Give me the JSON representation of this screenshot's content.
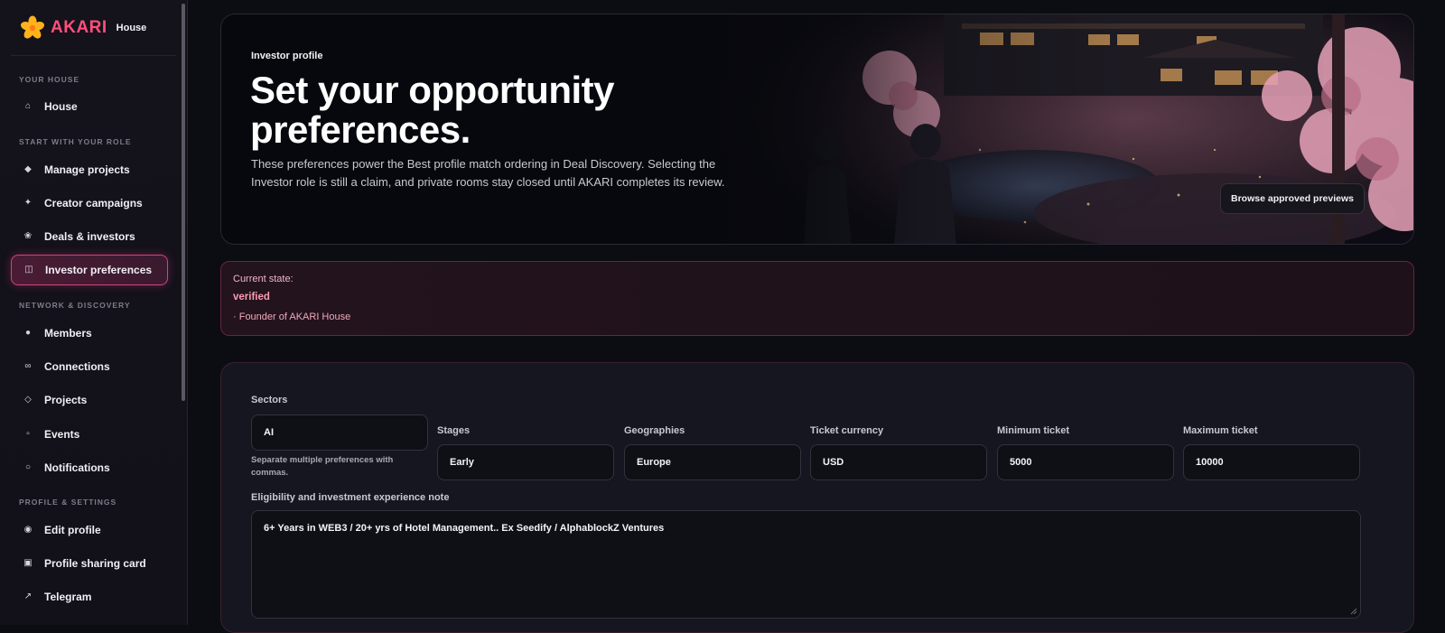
{
  "brand": {
    "name": "AKARI",
    "sub": "House",
    "accent": "#ff4f7a"
  },
  "sidebar": {
    "sections": [
      {
        "title": "YOUR HOUSE",
        "items": [
          {
            "label": "House",
            "icon": "home-icon"
          }
        ]
      },
      {
        "title": "START WITH YOUR ROLE",
        "items": [
          {
            "label": "Manage projects",
            "icon": "diamond-icon"
          },
          {
            "label": "Creator campaigns",
            "icon": "sparkle-icon"
          },
          {
            "label": "Deals & investors",
            "icon": "flower-icon"
          },
          {
            "label": "Investor preferences",
            "icon": "panel-icon",
            "active": true
          }
        ]
      },
      {
        "title": "NETWORK & DISCOVERY",
        "items": [
          {
            "label": "Members",
            "icon": "members-icon"
          },
          {
            "label": "Connections",
            "icon": "infinity-icon"
          },
          {
            "label": "Projects",
            "icon": "diamond-outline-icon"
          },
          {
            "label": "Events",
            "icon": "square-icon"
          },
          {
            "label": "Notifications",
            "icon": "circle-icon"
          }
        ]
      },
      {
        "title": "PROFILE & SETTINGS",
        "items": [
          {
            "label": "Edit profile",
            "icon": "profile-icon"
          },
          {
            "label": "Profile sharing card",
            "icon": "card-icon"
          },
          {
            "label": "Telegram",
            "icon": "arrow-icon"
          }
        ]
      }
    ]
  },
  "hero": {
    "eyebrow": "Investor profile",
    "title": "Set your opportunity preferences.",
    "description": "These preferences power the Best profile match ordering in Deal Discovery. Selecting the Investor role is still a claim, and private rooms stay closed until AKARI completes its review.",
    "button": "Browse approved previews"
  },
  "state": {
    "label": "Current state:",
    "value": "verified",
    "role": "· Founder of AKARI House"
  },
  "form": {
    "sectors": {
      "label": "Sectors",
      "value": "AI",
      "hint": "Separate multiple preferences with commas."
    },
    "stages": {
      "label": "Stages",
      "value": "Early"
    },
    "geographies": {
      "label": "Geographies",
      "value": "Europe"
    },
    "currency": {
      "label": "Ticket currency",
      "value": "USD"
    },
    "min_ticket": {
      "label": "Minimum ticket",
      "value": "5000"
    },
    "max_ticket": {
      "label": "Maximum ticket",
      "value": "10000"
    },
    "note": {
      "label": "Eligibility and investment experience note",
      "value": "6+ Years in WEB3 / 20+ yrs of Hotel Management.. Ex Seedify / AlphablockZ Ventures"
    }
  }
}
